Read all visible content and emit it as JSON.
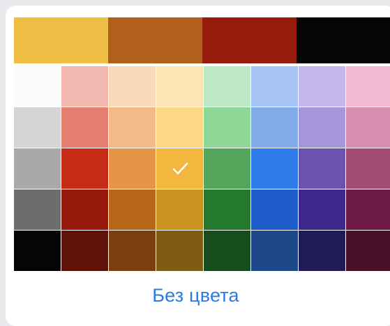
{
  "recent_colors": [
    {
      "name": "swatch-yellow",
      "color": "#efbf45"
    },
    {
      "name": "swatch-amber-brown",
      "color": "#b15f1a"
    },
    {
      "name": "swatch-dark-red",
      "color": "#961b0a"
    },
    {
      "name": "swatch-black",
      "color": "#050505"
    }
  ],
  "palette": {
    "rows": [
      [
        "#fbfbfb",
        "#f2b9b1",
        "#fad9bb",
        "#fbe5b4",
        "#bde8c5",
        "#a7c6f5",
        "#c4b9ea",
        "#f3b9d3"
      ],
      [
        "#d5d5d5",
        "#e37e70",
        "#f2ba88",
        "#fcd888",
        "#8dd797",
        "#83abea",
        "#a696da",
        "#d98db0"
      ],
      [
        "#a9a9a9",
        "#c52b17",
        "#e79348",
        "#f3b73f",
        "#53a65b",
        "#2f7be9",
        "#6b52ae",
        "#a04c74"
      ],
      [
        "#6d6d6d",
        "#97190b",
        "#b66618",
        "#c99324",
        "#25792f",
        "#1e5cc9",
        "#3d288b",
        "#6e1a46"
      ],
      [
        "#050505",
        "#5f1308",
        "#7a3e11",
        "#7e5c12",
        "#174c1d",
        "#1d4788",
        "#1f1b58",
        "#481029"
      ]
    ],
    "selected": {
      "row": 2,
      "col": 3
    },
    "check_icon": "checkmark-icon"
  },
  "no_color_label": "Без цвета",
  "accent_color": "#2a7ae2"
}
